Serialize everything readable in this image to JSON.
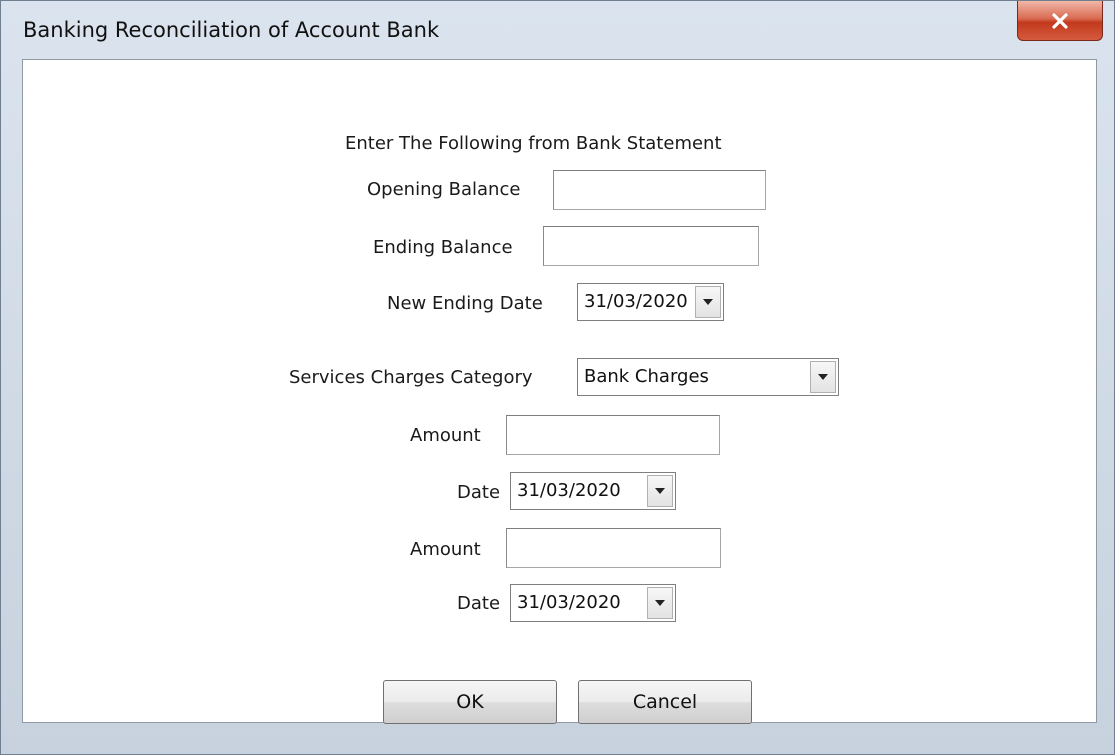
{
  "window": {
    "title": "Banking Reconciliation of Account Bank"
  },
  "form": {
    "heading": "Enter The Following from Bank Statement",
    "opening_balance": {
      "label": "Opening Balance",
      "value": ""
    },
    "ending_balance": {
      "label": "Ending Balance",
      "value": ""
    },
    "new_ending_date": {
      "label": "New Ending Date",
      "value": "31/03/2020"
    },
    "services_charges_category": {
      "label": "Services Charges Category",
      "value": "Bank Charges"
    },
    "amount_1": {
      "label": "Amount",
      "value": ""
    },
    "date_1": {
      "label": "Date",
      "value": "31/03/2020"
    },
    "amount_2": {
      "label": "Amount",
      "value": ""
    },
    "date_2": {
      "label": "Date",
      "value": "31/03/2020"
    }
  },
  "buttons": {
    "ok": "OK",
    "cancel": "Cancel"
  },
  "icons": {
    "close": "close-icon",
    "dropdown": "chevron-down-icon"
  },
  "colors": {
    "close_button": "#c8432a",
    "window_frame": "#cfd9e4",
    "client_background": "#ffffff"
  }
}
